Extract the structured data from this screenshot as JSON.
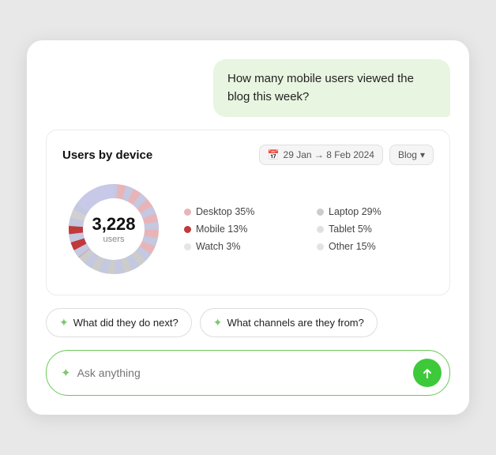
{
  "chat": {
    "bubble_text": "How many mobile users viewed the blog this week?"
  },
  "analytics": {
    "title": "Users by device",
    "date_range": "29 Jan → 8 Feb 2024",
    "filter": "Blog",
    "filter_arrow": "▾",
    "total_users_number": "3,228",
    "total_users_label": "users",
    "legend": [
      {
        "label": "Desktop 35%",
        "color": "#e8b4b8",
        "opacity": 0.5
      },
      {
        "label": "Laptop 29%",
        "color": "#c8c8c8",
        "opacity": 0.5
      },
      {
        "label": "Mobile 13%",
        "color": "#c0393b"
      },
      {
        "label": "Tablet 5%",
        "color": "#c8c8c8",
        "opacity": 0.4
      },
      {
        "label": "Watch 3%",
        "color": "#c8c8c8",
        "opacity": 0.35
      },
      {
        "label": "Other 15%",
        "color": "#c8c8c8",
        "opacity": 0.45
      }
    ]
  },
  "suggestions": [
    {
      "label": "What did they do next?"
    },
    {
      "label": "What channels are they from?"
    }
  ],
  "input": {
    "placeholder": "Ask anything",
    "sparkle": "✦"
  }
}
